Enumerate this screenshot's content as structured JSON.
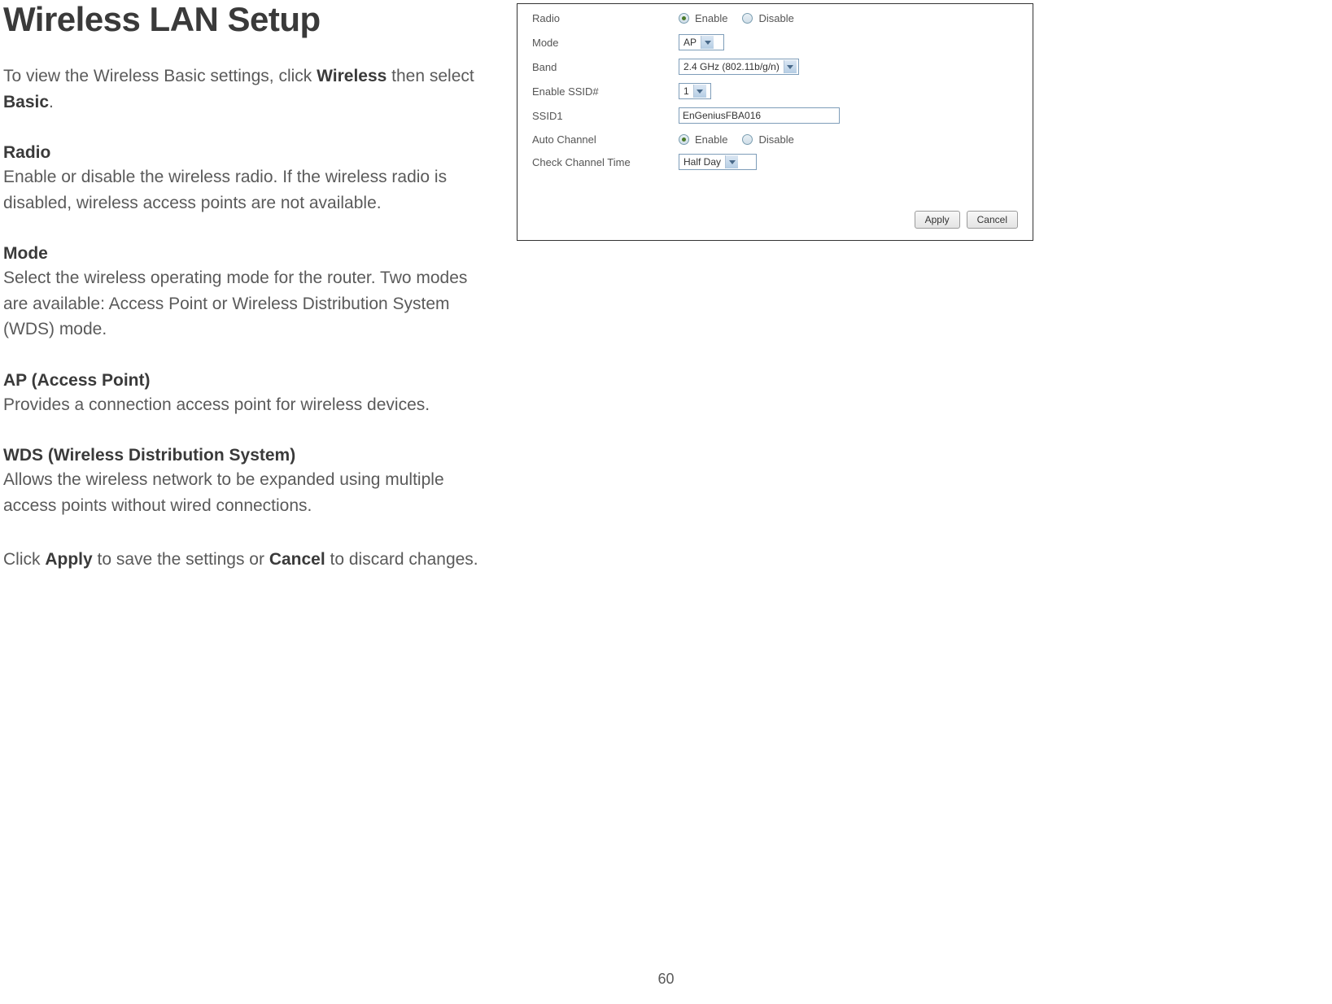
{
  "doc": {
    "title": "Wireless LAN Setup",
    "intro_pre": "To view the Wireless Basic settings, click ",
    "intro_bold1": "Wireless",
    "intro_mid": " then select ",
    "intro_bold2": "Basic",
    "intro_post": ".",
    "sections": {
      "radio": {
        "title": "Radio",
        "body": "Enable or disable the wireless radio. If the wireless radio is disabled, wireless access points are not available."
      },
      "mode": {
        "title": "Mode",
        "body": "Select the wireless operating mode for the router. Two modes are available: Access Point or Wireless Distribution System (WDS) mode."
      },
      "ap": {
        "title": "AP (Access Point)",
        "body": "Provides a connection access point for wireless devices."
      },
      "wds": {
        "title": "WDS (Wireless Distribution System)",
        "body": "Allows the wireless network to be expanded using multiple access points without wired connections."
      }
    },
    "closing_pre": "Click ",
    "closing_bold1": "Apply",
    "closing_mid": " to save the settings or ",
    "closing_bold2": "Cancel",
    "closing_post": " to discard changes.",
    "page_number": "60"
  },
  "panel": {
    "labels": {
      "radio": "Radio",
      "mode": "Mode",
      "band": "Band",
      "enable_ssid": "Enable SSID#",
      "ssid1": "SSID1",
      "auto_channel": "Auto Channel",
      "check_channel_time": "Check Channel Time"
    },
    "radio_options": {
      "enable": "Enable",
      "disable": "Disable"
    },
    "values": {
      "mode": "AP",
      "band": "2.4 GHz (802.11b/g/n)",
      "enable_ssid": "1",
      "ssid1": "EnGeniusFBA016",
      "check_channel_time": "Half Day"
    },
    "buttons": {
      "apply": "Apply",
      "cancel": "Cancel"
    }
  }
}
